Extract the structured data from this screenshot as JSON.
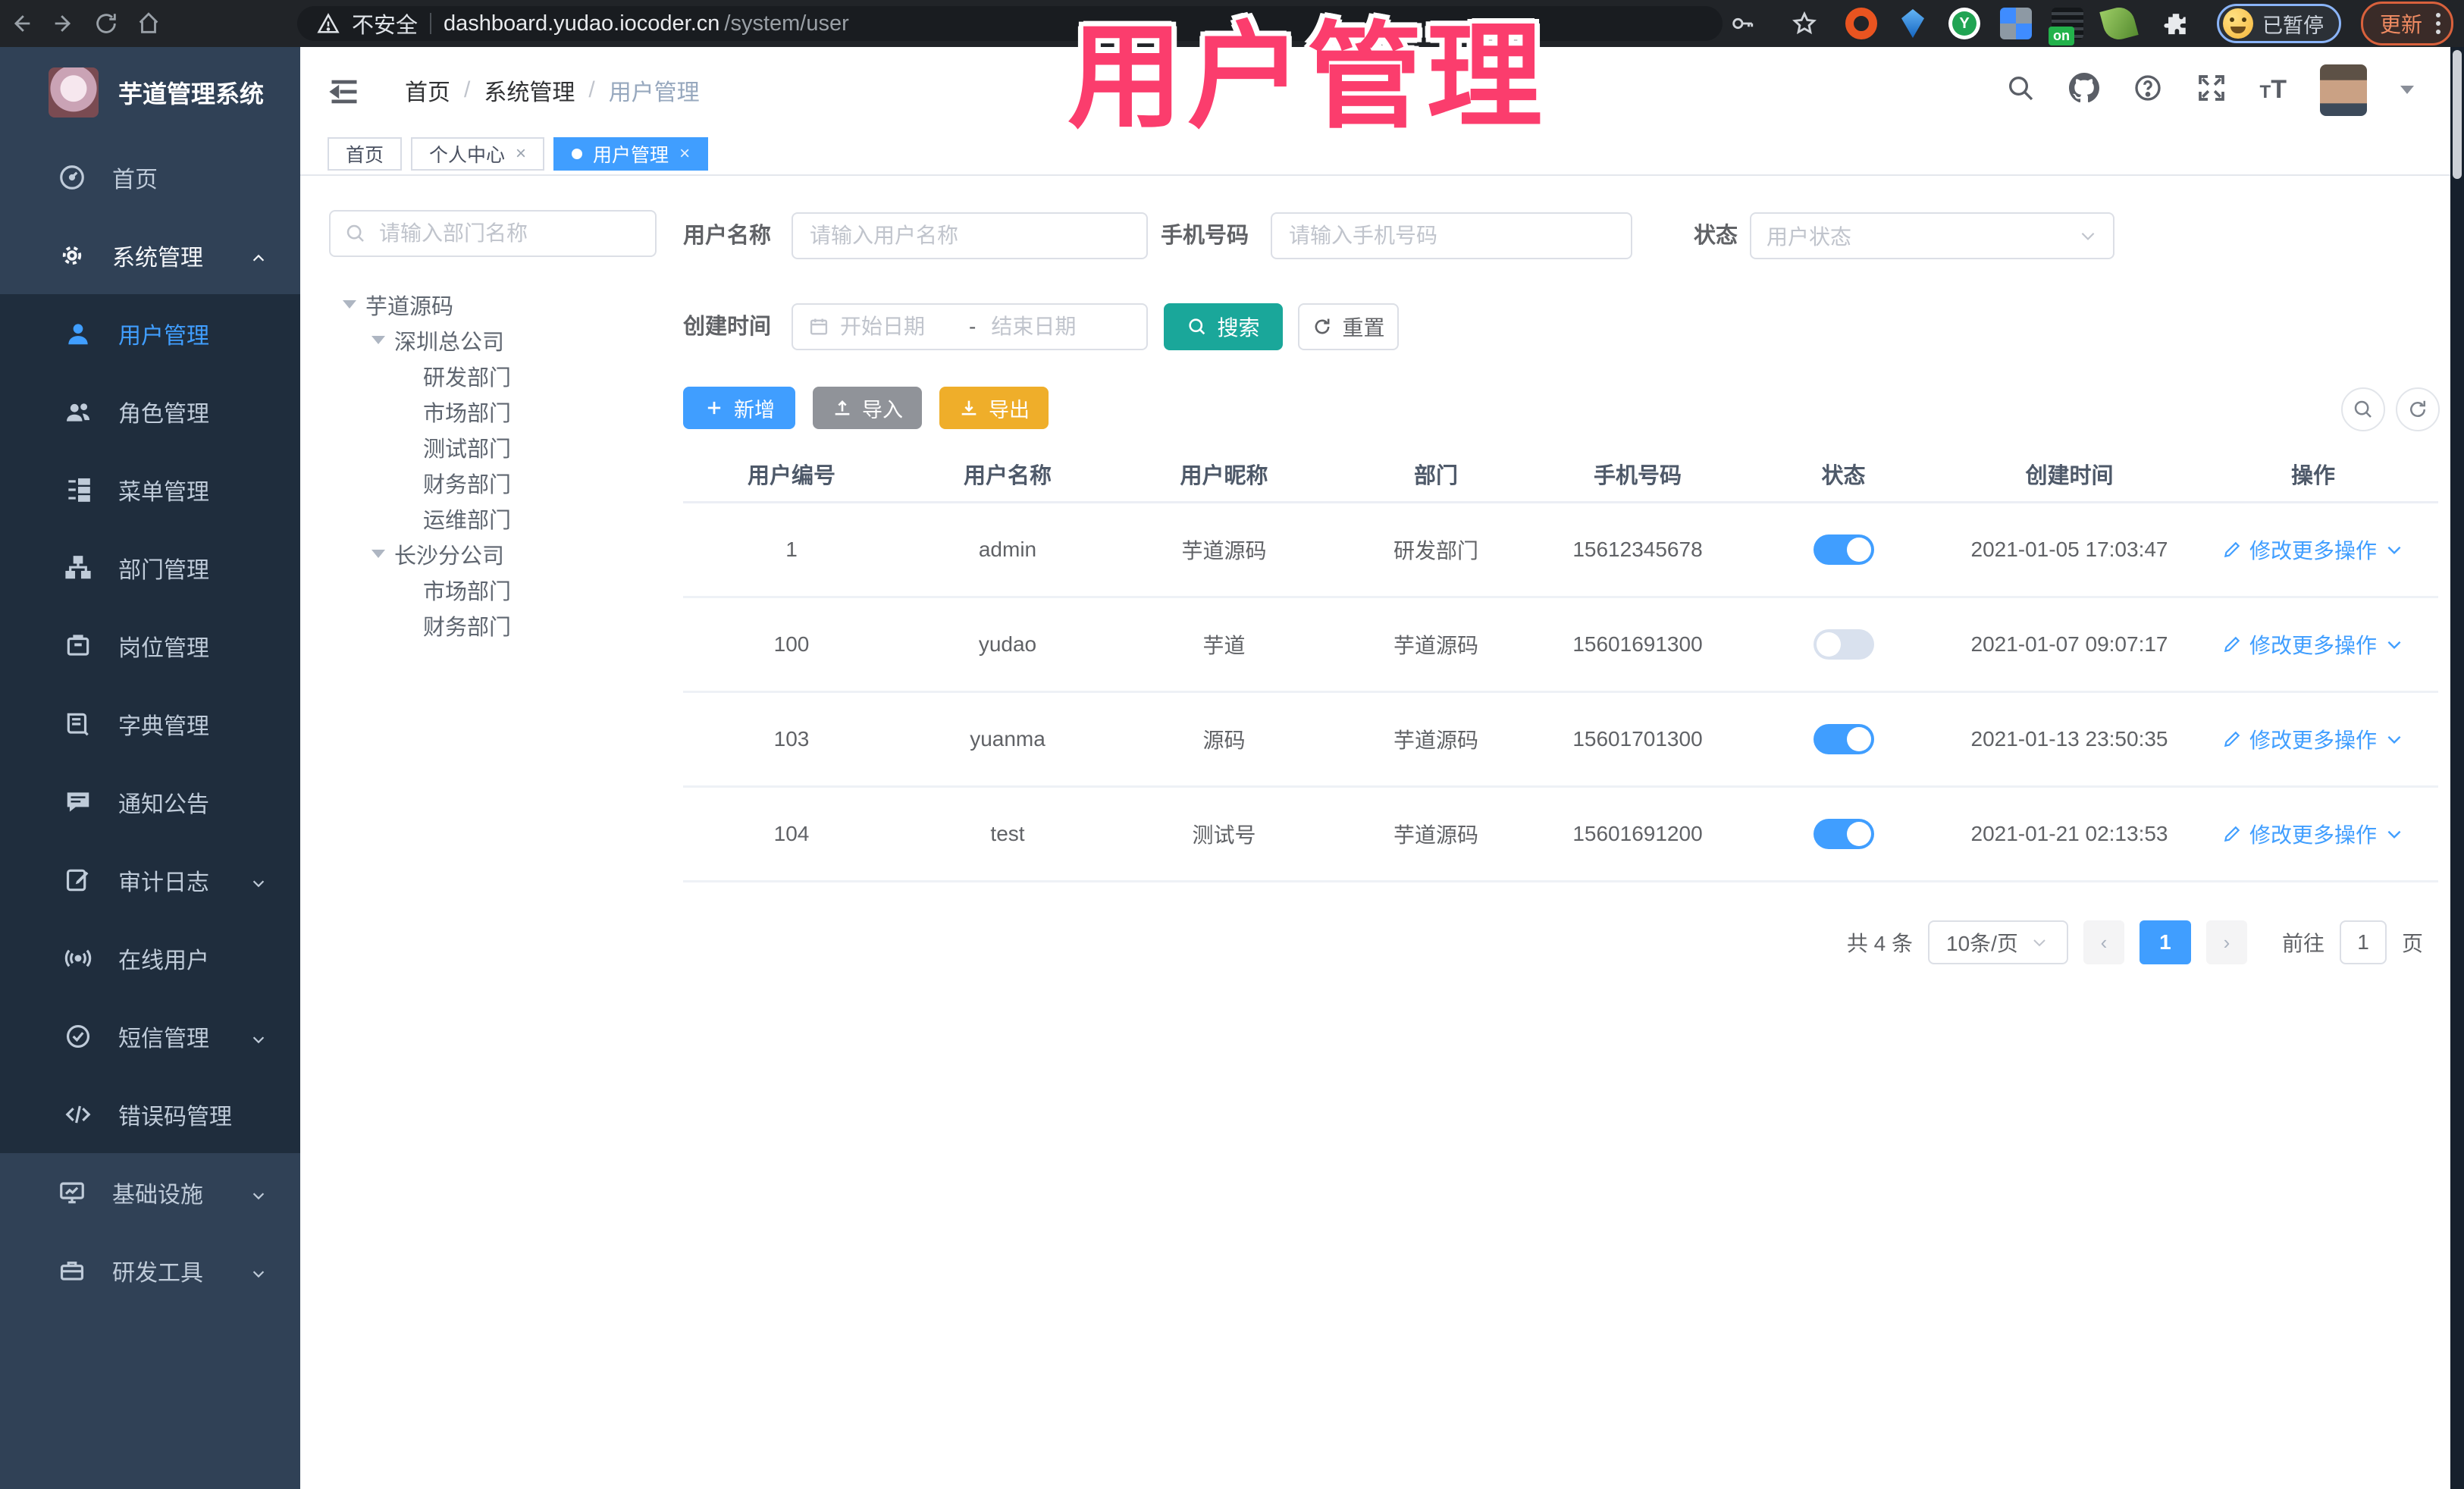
{
  "browser": {
    "security_label": "不安全",
    "url_host": "dashboard.yudao.iocoder.cn",
    "url_path": "/system/user",
    "extension_badge": "on",
    "paused_label": "已暂停",
    "update_label": "更新"
  },
  "overlay_title": "用户管理",
  "colors": {
    "accent": "#409EFF",
    "search_button": "#1aa79a",
    "export_button": "#efae2a",
    "overlay_text": "#fb3d6d",
    "sidebar_bg": "#304156",
    "submenu_bg": "#1f2d3d"
  },
  "sidebar": {
    "logo_title": "芋道管理系统",
    "items": [
      {
        "label": "首页"
      },
      {
        "label": "系统管理"
      },
      {
        "label": "用户管理"
      },
      {
        "label": "角色管理"
      },
      {
        "label": "菜单管理"
      },
      {
        "label": "部门管理"
      },
      {
        "label": "岗位管理"
      },
      {
        "label": "字典管理"
      },
      {
        "label": "通知公告"
      },
      {
        "label": "审计日志"
      },
      {
        "label": "在线用户"
      },
      {
        "label": "短信管理"
      },
      {
        "label": "错误码管理"
      },
      {
        "label": "基础设施"
      },
      {
        "label": "研发工具"
      }
    ]
  },
  "breadcrumb": [
    "首页",
    "系统管理",
    "用户管理"
  ],
  "tabs": [
    {
      "label": "首页"
    },
    {
      "label": "个人中心"
    },
    {
      "label": "用户管理"
    }
  ],
  "tree": {
    "search_placeholder": "请输入部门名称",
    "nodes": [
      {
        "label": "芋道源码"
      },
      {
        "label": "深圳总公司"
      },
      {
        "label": "研发部门"
      },
      {
        "label": "市场部门"
      },
      {
        "label": "测试部门"
      },
      {
        "label": "财务部门"
      },
      {
        "label": "运维部门"
      },
      {
        "label": "长沙分公司"
      },
      {
        "label": "市场部门"
      },
      {
        "label": "财务部门"
      }
    ]
  },
  "filters": {
    "username_label": "用户名称",
    "username_placeholder": "请输入用户名称",
    "mobile_label": "手机号码",
    "mobile_placeholder": "请输入手机号码",
    "status_label": "状态",
    "status_placeholder": "用户状态",
    "created_label": "创建时间",
    "date_start_placeholder": "开始日期",
    "date_separator": "-",
    "date_end_placeholder": "结束日期",
    "search_button": "搜索",
    "reset_button": "重置"
  },
  "toolbar": {
    "add_label": "新增",
    "import_label": "导入",
    "export_label": "导出"
  },
  "table": {
    "columns": [
      "用户编号",
      "用户名称",
      "用户昵称",
      "部门",
      "手机号码",
      "状态",
      "创建时间",
      "操作"
    ],
    "action": {
      "edit": "修改",
      "more": "更多操作"
    },
    "rows": [
      {
        "id": "1",
        "username": "admin",
        "nickname": "芋道源码",
        "dept": "研发部门",
        "mobile": "15612345678",
        "status": "on",
        "created": "2021-01-05 17:03:47"
      },
      {
        "id": "100",
        "username": "yudao",
        "nickname": "芋道",
        "dept": "芋道源码",
        "mobile": "15601691300",
        "status": "off",
        "created": "2021-01-07 09:07:17"
      },
      {
        "id": "103",
        "username": "yuanma",
        "nickname": "源码",
        "dept": "芋道源码",
        "mobile": "15601701300",
        "status": "on",
        "created": "2021-01-13 23:50:35"
      },
      {
        "id": "104",
        "username": "test",
        "nickname": "测试号",
        "dept": "芋道源码",
        "mobile": "15601691200",
        "status": "on",
        "created": "2021-01-21 02:13:53"
      }
    ]
  },
  "pagination": {
    "total": "共 4 条",
    "page_size": "10条/页",
    "current_page": "1",
    "goto_label": "前往",
    "goto_value": "1",
    "unit_label": "页"
  }
}
